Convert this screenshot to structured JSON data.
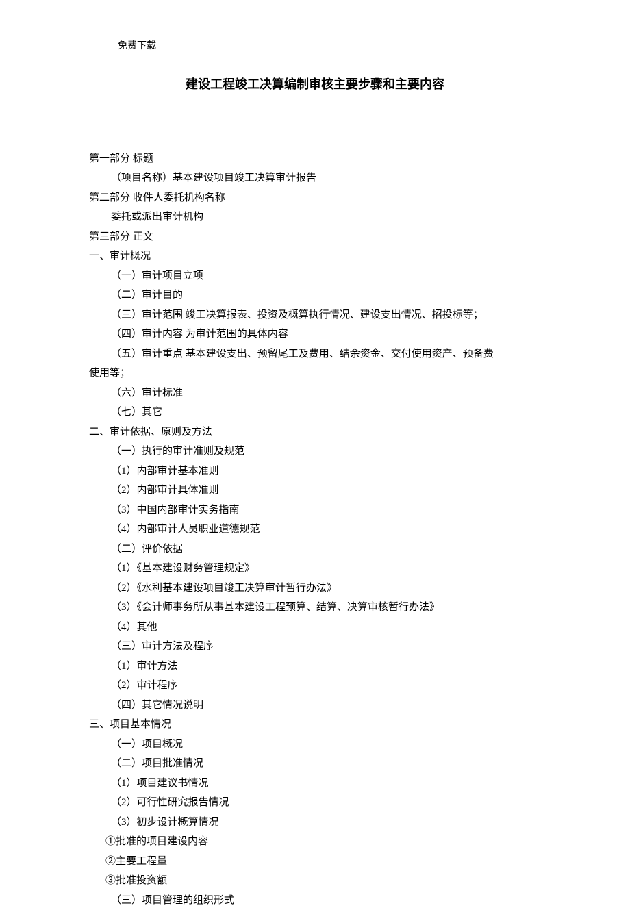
{
  "header_note": "免费下载",
  "title": "建设工程竣工决算编制审核主要步骤和主要内容",
  "lines": [
    {
      "cls": "lvl0",
      "text": "第一部分 标题"
    },
    {
      "cls": "lvl1",
      "text": "（项目名称）基本建设项目竣工决算审计报告"
    },
    {
      "cls": "lvl0",
      "text": "第二部分 收件人委托机构名称"
    },
    {
      "cls": "lvl1",
      "text": "委托或派出审计机构"
    },
    {
      "cls": "lvl0",
      "text": "第三部分 正文"
    },
    {
      "cls": "lvl0",
      "text": "一、审计概况"
    },
    {
      "cls": "lvl2",
      "text": "（一）审计项目立项"
    },
    {
      "cls": "lvl2",
      "text": "（二）审计目的"
    },
    {
      "cls": "lvl2",
      "text": "（三）审计范围 竣工决算报表、投资及概算执行情况、建设支出情况、招投标等；"
    },
    {
      "cls": "lvl2",
      "text": "（四）审计内容 为审计范围的具体内容"
    },
    {
      "cls": "lvl2",
      "text": "（五）审计重点 基本建设支出、预留尾工及费用、结余资金、交付使用资产、预备费"
    },
    {
      "cls": "wrap-cont",
      "text": "使用等；"
    },
    {
      "cls": "lvl2",
      "text": "（六）审计标准"
    },
    {
      "cls": "lvl2",
      "text": "（七）其它"
    },
    {
      "cls": "lvl0",
      "text": "二、审计依据、原则及方法"
    },
    {
      "cls": "lvl2",
      "text": "（一）执行的审计准则及规范"
    },
    {
      "cls": "lvl2",
      "text": "（1）内部审计基本准则"
    },
    {
      "cls": "lvl2",
      "text": "（2）内部审计具体准则"
    },
    {
      "cls": "lvl2",
      "text": "（3）中国内部审计实务指南"
    },
    {
      "cls": "lvl2",
      "text": "（4）内部审计人员职业道德规范"
    },
    {
      "cls": "lvl2",
      "text": "（二）评价依据"
    },
    {
      "cls": "lvl2",
      "text": "（1）《基本建设财务管理规定》"
    },
    {
      "cls": "lvl2",
      "text": "（2）《水利基本建设项目竣工决算审计暂行办法》"
    },
    {
      "cls": "lvl2",
      "text": "（3）《会计师事务所从事基本建设工程预算、结算、决算审核暂行办法》"
    },
    {
      "cls": "lvl2",
      "text": "（4）其他"
    },
    {
      "cls": "lvl2",
      "text": "（三）审计方法及程序"
    },
    {
      "cls": "lvl2",
      "text": "（1）审计方法"
    },
    {
      "cls": "lvl2",
      "text": "（2）审计程序"
    },
    {
      "cls": "lvl2",
      "text": "（四）其它情况说明"
    },
    {
      "cls": "lvl0",
      "text": "三、项目基本情况"
    },
    {
      "cls": "lvl2",
      "text": "（一）项目概况"
    },
    {
      "cls": "lvl2",
      "text": "（二）项目批准情况"
    },
    {
      "cls": "lvl2",
      "text": "（1）项目建议书情况"
    },
    {
      "cls": "lvl2",
      "text": "（2）可行性研究报告情况"
    },
    {
      "cls": "lvl2",
      "text": "（3）初步设计概算情况"
    },
    {
      "cls": "lvl3",
      "text": "①批准的项目建设内容"
    },
    {
      "cls": "lvl3",
      "text": "②主要工程量"
    },
    {
      "cls": "lvl3",
      "text": "③批准投资额"
    },
    {
      "cls": "lvl2",
      "text": "（三）项目管理的组织形式"
    }
  ]
}
